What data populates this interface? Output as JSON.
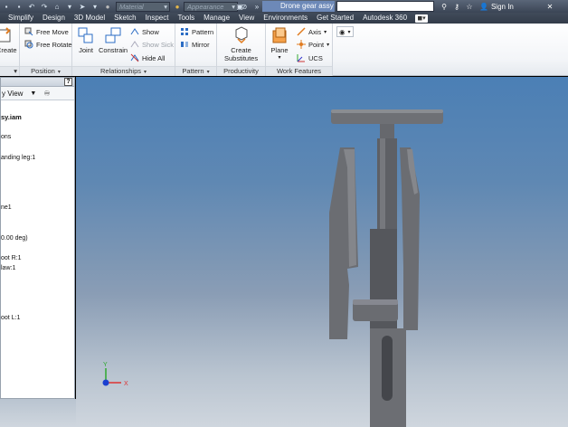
{
  "quick_access": {
    "material": "Material",
    "appearance": "Appearance",
    "document_title": "Drone gear assy",
    "sign_in": "Sign In"
  },
  "menu": {
    "tabs": [
      "Simplify",
      "Design",
      "3D Model",
      "Sketch",
      "Inspect",
      "Tools",
      "Manage",
      "View",
      "Environments",
      "Get Started",
      "Autodesk 360"
    ]
  },
  "ribbon": {
    "create": "Create",
    "free_move": "Free Move",
    "free_rotate": "Free Rotate",
    "position_panel": "Position",
    "joint": "Joint",
    "constrain": "Constrain",
    "show": "Show",
    "show_sick": "Show Sick",
    "hide_all": "Hide All",
    "relationships_panel": "Relationships",
    "pattern": "Pattern",
    "mirror": "Mirror",
    "pattern_panel": "Pattern",
    "create_substitutes_1": "Create",
    "create_substitutes_2": "Substitutes",
    "productivity_panel": "Productivity",
    "plane": "Plane",
    "axis": "Axis",
    "point": "Point",
    "ucs": "UCS",
    "work_features_panel": "Work Features"
  },
  "browser": {
    "view_label": "y View",
    "items": [
      "sy.iam",
      "ons",
      "anding leg:1",
      "ne1",
      "0.00 deg)",
      "oot R:1",
      "law:1",
      "oot L:1"
    ]
  },
  "viewport": {
    "triad_x": "X",
    "triad_y": "Y"
  },
  "colors": {
    "accent": "#6d89b8",
    "viewport_top": "#4b7fb5",
    "viewport_bottom": "#cfd6de",
    "part_gray": "#707379"
  }
}
